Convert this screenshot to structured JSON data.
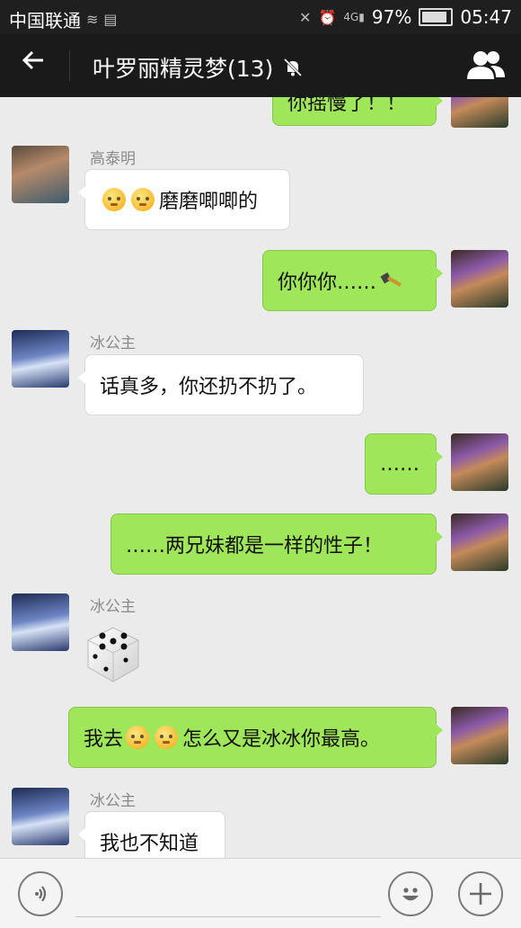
{
  "status_bar": {
    "carrier": "中国联通",
    "battery": "97%",
    "time": "05:47",
    "icons": [
      "signal-icon",
      "sd-card-icon",
      "mute-vibrate-icon",
      "alarm-icon",
      "4g-signal-icon",
      "battery-icon"
    ]
  },
  "header": {
    "title": "叶罗丽精灵梦(13)",
    "icons": [
      "back-arrow-icon",
      "mute-bell-icon",
      "group-members-icon"
    ]
  },
  "messages": [
    {
      "side": "right",
      "text": "你摇慢了！！",
      "partial": true
    },
    {
      "side": "left",
      "sender": "高泰明",
      "emojis": 2,
      "text": "磨磨唧唧的"
    },
    {
      "side": "right",
      "text": "你你你……",
      "icon": "hammer-icon"
    },
    {
      "side": "left",
      "sender": "冰公主",
      "text": "话真多，你还扔不扔了。"
    },
    {
      "side": "right",
      "text": "……"
    },
    {
      "side": "right",
      "text": "……两兄妹都是一样的性子！"
    },
    {
      "side": "left",
      "sender": "冰公主",
      "sticker": "dice-icon",
      "dice_value": 5
    },
    {
      "side": "right",
      "text_a": "我去",
      "emojis": 2,
      "text_b": "怎么又是冰冰你最高。"
    },
    {
      "side": "left",
      "sender": "冰公主",
      "text": "我也不知道"
    }
  ],
  "input_bar": {
    "icons": [
      "voice-icon",
      "emoji-face-icon",
      "plus-icon"
    ]
  },
  "colors": {
    "green_bubble": "#9fe65a",
    "white_bubble": "#ffffff",
    "header_bg": "#1a1a1a",
    "chat_bg": "#ebebeb"
  }
}
